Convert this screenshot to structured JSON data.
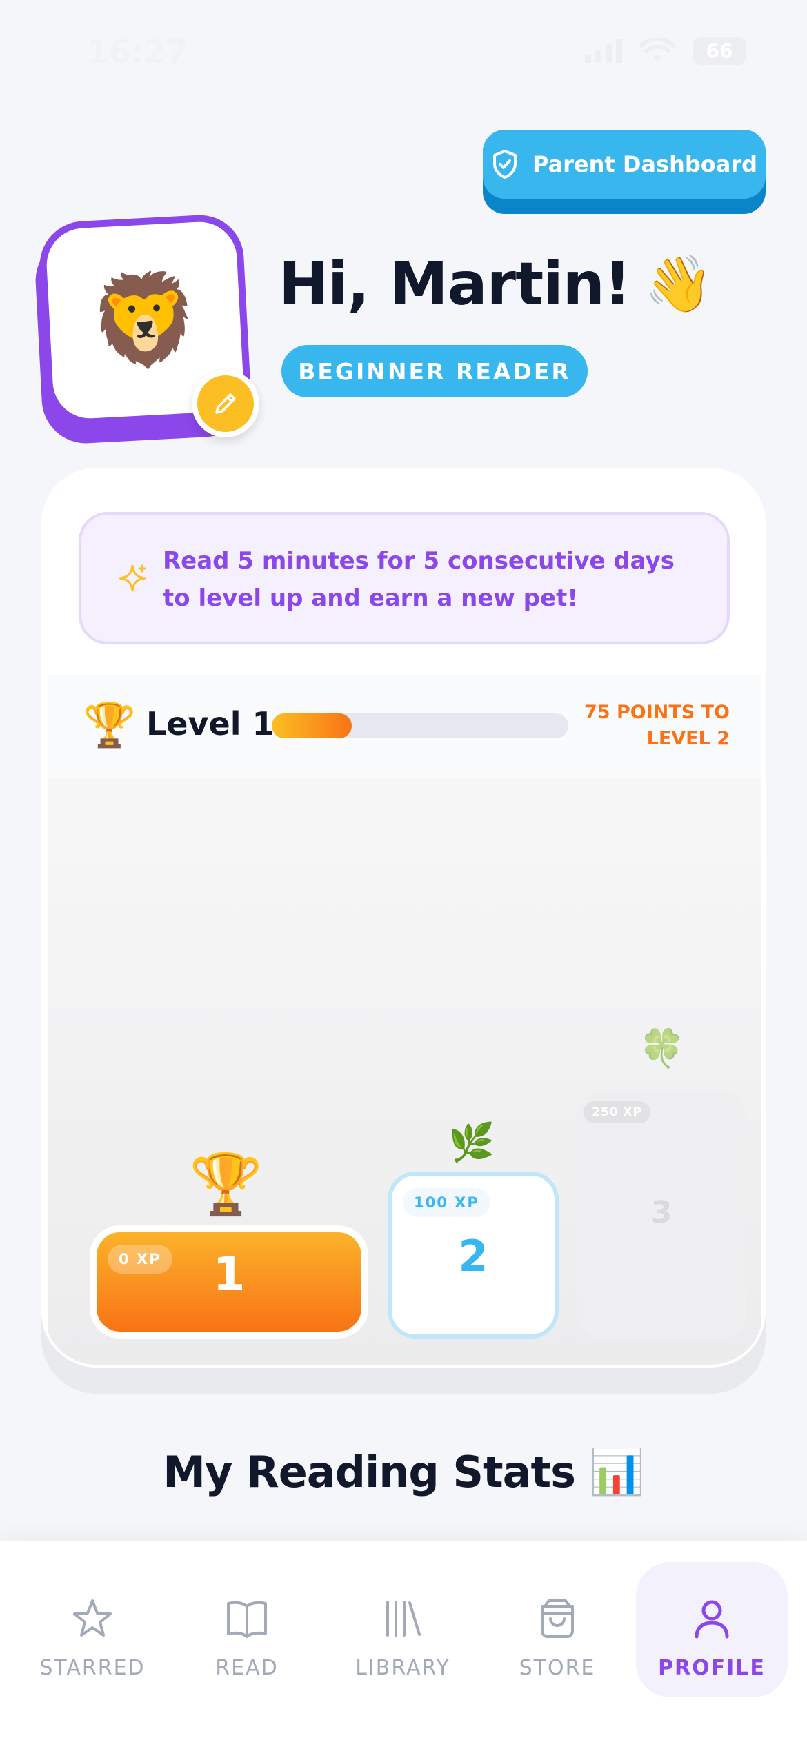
{
  "status": {
    "time": "16:27",
    "battery": "66"
  },
  "header": {
    "parent_dashboard_label": "Parent Dashboard",
    "greeting": "Hi, Martin!",
    "greeting_emoji": "👋",
    "reader_level": "BEGINNER READER",
    "avatar_emoji": "🦁"
  },
  "goal": {
    "tip": "Read 5 minutes for 5 consecutive days to level up and earn a new pet!"
  },
  "level": {
    "label": "Level 1",
    "progress_percent": 27,
    "points_to_next_line1": "75 POINTS TO",
    "points_to_next_line2": "LEVEL 2"
  },
  "podium": {
    "steps": [
      {
        "xp": "0 XP",
        "number": "1",
        "icon": "🏆"
      },
      {
        "xp": "100 XP",
        "number": "2",
        "icon": "🌿"
      },
      {
        "xp": "250 XP",
        "number": "3",
        "icon": "🍀"
      }
    ]
  },
  "stats": {
    "title": "My Reading Stats",
    "emoji": "📊"
  },
  "tabs": [
    {
      "label": "STARRED",
      "icon": "star-icon"
    },
    {
      "label": "READ",
      "icon": "book-icon"
    },
    {
      "label": "LIBRARY",
      "icon": "library-icon"
    },
    {
      "label": "STORE",
      "icon": "bag-icon"
    },
    {
      "label": "PROFILE",
      "icon": "person-icon",
      "active": true
    }
  ],
  "colors": {
    "accent_purple": "#8b47ea",
    "accent_blue": "#38b6ee",
    "accent_orange": "#f97316",
    "accent_yellow": "#fbbf24"
  }
}
